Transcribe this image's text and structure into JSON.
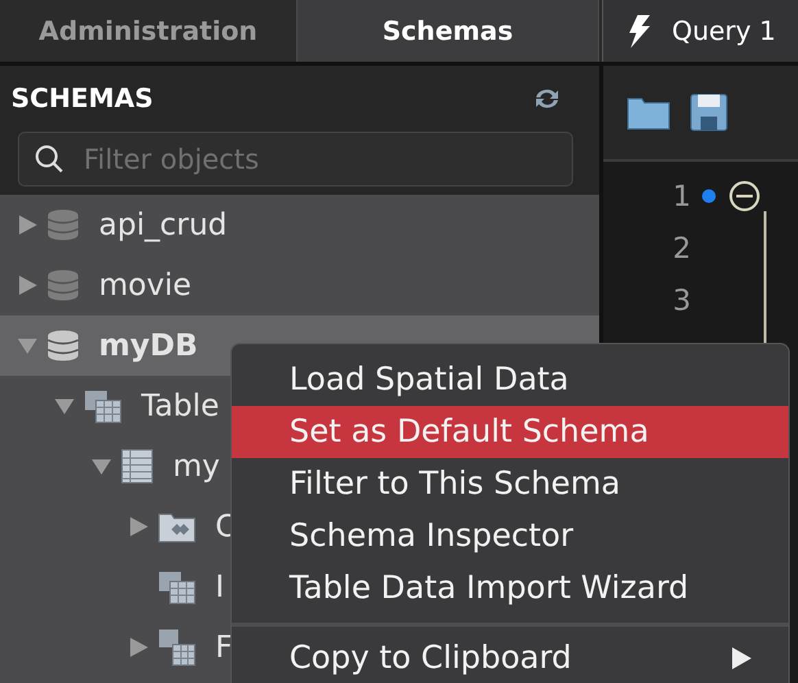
{
  "tabs": [
    {
      "label": "Administration",
      "selected": false
    },
    {
      "label": "Schemas",
      "selected": true
    }
  ],
  "query_tab": {
    "label": "Query 1"
  },
  "sidebar": {
    "title": "SCHEMAS",
    "filter": {
      "placeholder": "Filter objects"
    },
    "tree": [
      {
        "label": "api_crud",
        "kind": "schema",
        "expanded": false,
        "selected": false
      },
      {
        "label": "movie",
        "kind": "schema",
        "expanded": false,
        "selected": false
      },
      {
        "label": "myDB",
        "kind": "schema",
        "expanded": true,
        "selected": true,
        "children": [
          {
            "label": "Table",
            "kind": "tables",
            "expanded": true,
            "selected": false,
            "children": [
              {
                "label": "my",
                "kind": "table",
                "expanded": true,
                "selected": false,
                "children": [
                  {
                    "label": "C",
                    "kind": "columns",
                    "expanded": false,
                    "selected": false
                  },
                  {
                    "label": "I",
                    "kind": "indexes",
                    "selected": false
                  },
                  {
                    "label": "F",
                    "kind": "foreign-keys",
                    "expanded": false,
                    "selected": false
                  }
                ]
              }
            ]
          }
        ]
      }
    ]
  },
  "editor": {
    "lines": [
      {
        "number": "1",
        "current": true,
        "foldable": true
      },
      {
        "number": "2",
        "current": false,
        "foldable": false
      },
      {
        "number": "3",
        "current": false,
        "foldable": false
      }
    ]
  },
  "context_menu": {
    "items": [
      {
        "kind": "item",
        "label": "Load Spatial Data",
        "selected": false
      },
      {
        "kind": "item",
        "label": "Set as Default Schema",
        "selected": true
      },
      {
        "kind": "item",
        "label": "Filter to This Schema",
        "selected": false
      },
      {
        "kind": "item",
        "label": "Schema Inspector",
        "selected": false
      },
      {
        "kind": "item",
        "label": "Table Data Import Wizard",
        "selected": false
      },
      {
        "kind": "separator"
      },
      {
        "kind": "item",
        "label": "Copy to Clipboard",
        "selected": false,
        "submenu": true
      }
    ]
  }
}
